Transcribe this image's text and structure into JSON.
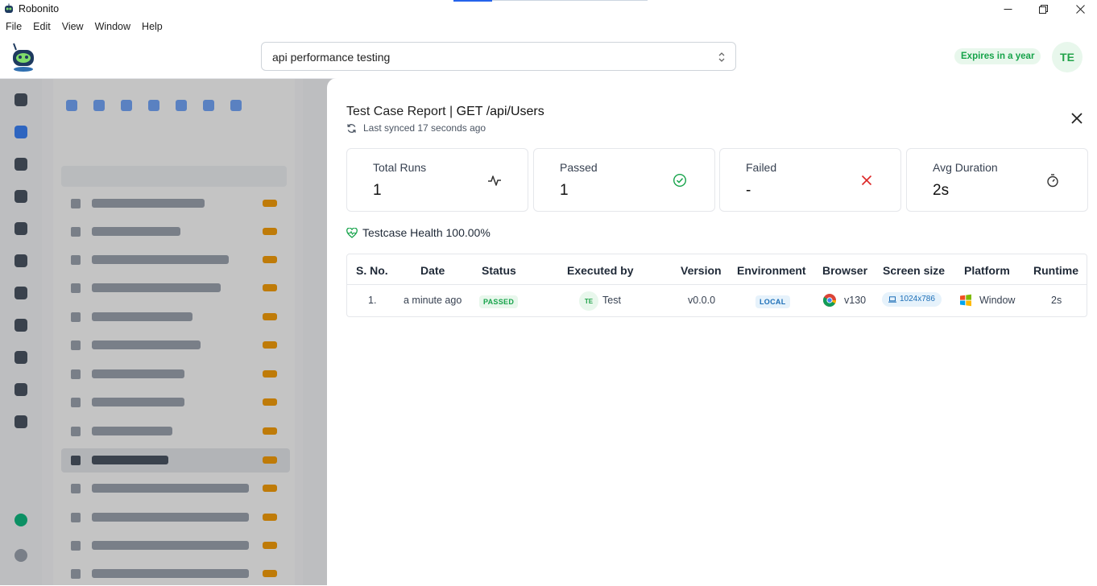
{
  "window": {
    "app_name": "Robonito"
  },
  "menu": [
    "File",
    "Edit",
    "View",
    "Window",
    "Help"
  ],
  "header": {
    "search_value": "api performance testing",
    "expires_label": "Expires in a year",
    "avatar_initials": "TE"
  },
  "report": {
    "title_prefix": "Test Case Report | ",
    "title_endpoint": "GET /api/Users",
    "last_synced": "Last synced 17 seconds ago",
    "stats": [
      {
        "label": "Total Runs",
        "value": "1",
        "icon": "activity-icon"
      },
      {
        "label": "Passed",
        "value": "1",
        "icon": "check-circle-icon"
      },
      {
        "label": "Failed",
        "value": "-",
        "icon": "x-icon"
      },
      {
        "label": "Avg Duration",
        "value": "2s",
        "icon": "stopwatch-icon"
      }
    ],
    "health": "Testcase Health 100.00%",
    "table": {
      "headers": [
        "S. No.",
        "Date",
        "Status",
        "Executed by",
        "Version",
        "Environment",
        "Browser",
        "Screen size",
        "Platform",
        "Runtime"
      ],
      "row": {
        "sno": "1.",
        "date": "a minute ago",
        "status": "PASSED",
        "executed_by_initials": "TE",
        "executed_by": "Test",
        "version": "v0.0.0",
        "environment": "LOCAL",
        "browser": "v130",
        "screen_size": "1024x786",
        "platform": "Window",
        "runtime": "2s"
      }
    }
  },
  "colors": {
    "accent_green": "#16a34a",
    "accent_blue": "#1d6fb8",
    "fail_red": "#dc2626"
  }
}
